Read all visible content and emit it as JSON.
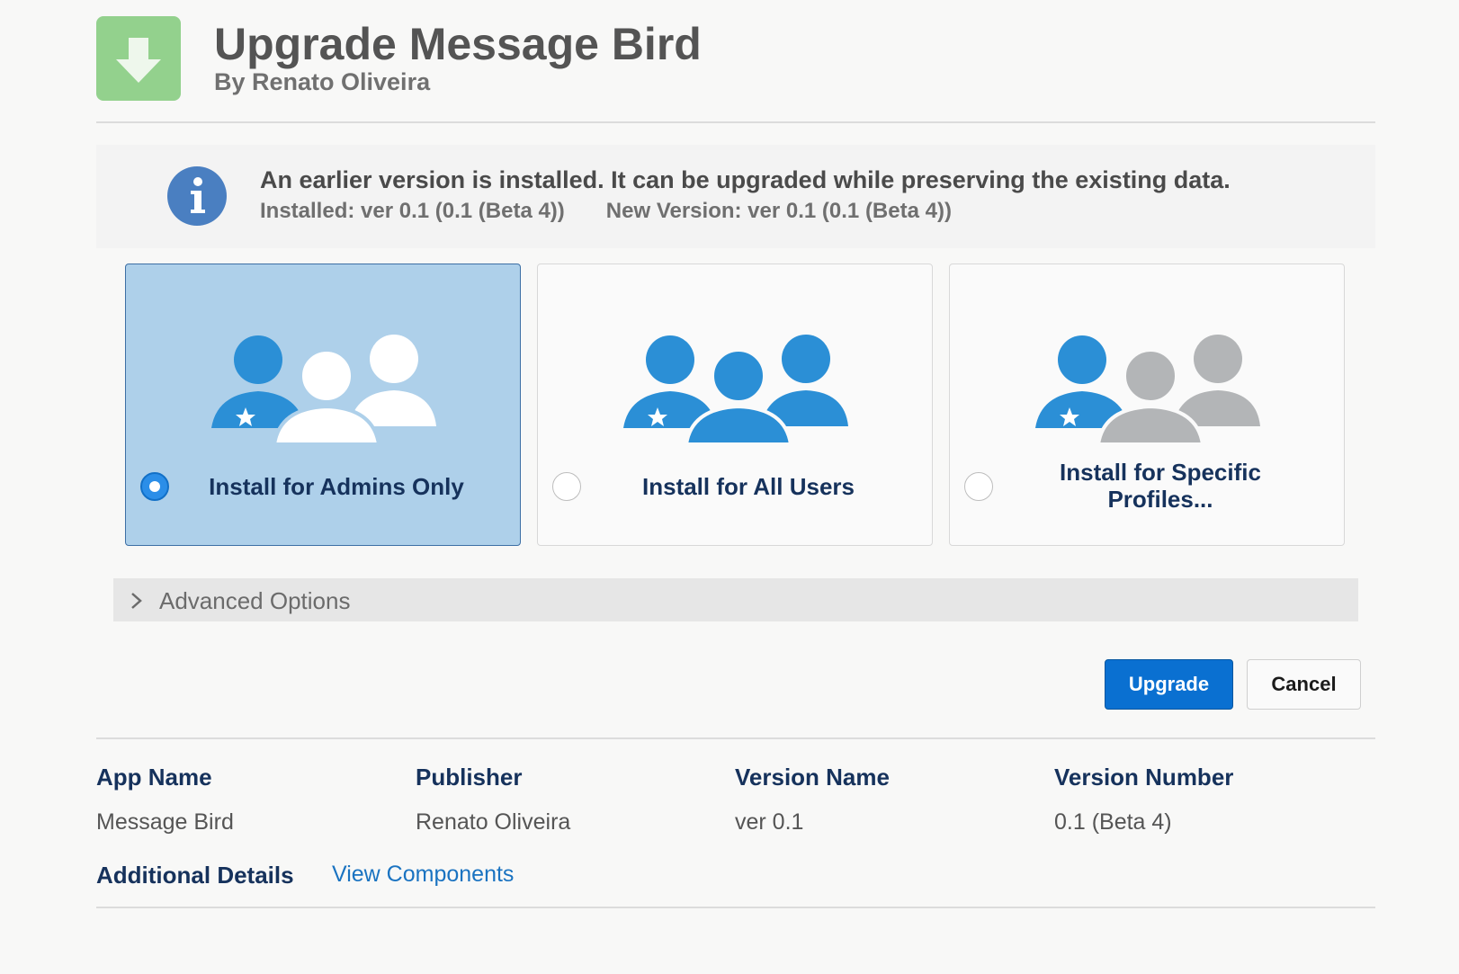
{
  "header": {
    "title": "Upgrade Message Bird",
    "subtitle": "By Renato Oliveira",
    "icon": "download-arrow-icon",
    "icon_color": "#93d18d"
  },
  "notice": {
    "message": "An earlier version is installed. It can be upgraded while preserving the existing data.",
    "installed": "Installed: ver 0.1 (0.1 (Beta 4))",
    "new_version": "New Version: ver 0.1 (0.1 (Beta 4))",
    "icon": "info-icon"
  },
  "install_options": [
    {
      "label": "Install for Admins Only",
      "selected": true,
      "icon": "admins-people-icon"
    },
    {
      "label": "Install for All Users",
      "selected": false,
      "icon": "all-users-people-icon"
    },
    {
      "label": "Install for Specific Profiles...",
      "selected": false,
      "icon": "specific-profiles-people-icon"
    }
  ],
  "advanced": {
    "label": "Advanced Options",
    "icon": "chevron-right-icon"
  },
  "buttons": {
    "upgrade": "Upgrade",
    "cancel": "Cancel"
  },
  "details": {
    "columns": [
      {
        "header": "App Name",
        "value": "Message Bird"
      },
      {
        "header": "Publisher",
        "value": "Renato Oliveira"
      },
      {
        "header": "Version Name",
        "value": "ver 0.1"
      },
      {
        "header": "Version Number",
        "value": "0.1 (Beta 4)"
      }
    ],
    "additional_label": "Additional Details",
    "view_components": "View Components"
  },
  "colors": {
    "primary": "#0a70d1",
    "selected_bg": "#aed0ea",
    "heading": "#16325c",
    "link": "#1a73c1",
    "person_blue": "#2b8fd6",
    "person_gray": "#b3b5b7"
  }
}
